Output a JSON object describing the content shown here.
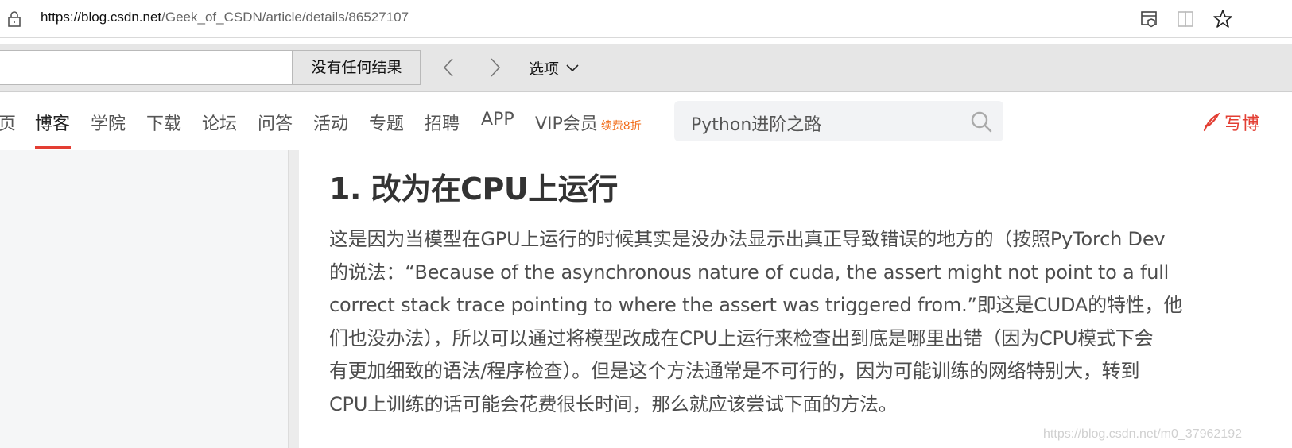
{
  "browser": {
    "url_host": "https://blog.csdn.net",
    "url_path": "/Geek_of_CSDN/article/details/86527107",
    "icons": [
      "lock-icon",
      "collections-icon",
      "reading-view-icon",
      "favorite-star-icon"
    ]
  },
  "find_bar": {
    "input_value": "",
    "result_label": "没有任何结果",
    "options_label": "选项"
  },
  "nav": {
    "items": [
      "页",
      "博客",
      "学院",
      "下载",
      "论坛",
      "问答",
      "活动",
      "专题",
      "招聘",
      "APP",
      "VIP会员"
    ],
    "active": "博客",
    "vip_badge": "续费8折",
    "search_text": "Python进阶之路",
    "write_label": "写博",
    "accent_color": "#e33e33"
  },
  "article": {
    "heading": "1. 改为在CPU上运行",
    "lines": [
      "这是因为当模型在GPU上运行的时候其实是没办法显示出真正导致错误的地方的（按照PyTorch Dev",
      "的说法：“Because of the asynchronous nature of cuda, the assert might not point to a full",
      "correct stack trace pointing to where the assert was triggered from.”即这是CUDA的特性，他",
      "们也没办法），所以可以通过将模型改成在CPU上运行来检查出到底是哪里出错（因为CPU模式下会",
      "有更加细致的语法/程序检查）。但是这个方法通常是不可行的，因为可能训练的网络特别大，转到",
      "CPU上训练的话可能会花费很长时间，那么就应该尝试下面的方法。"
    ],
    "watermark": "https://blog.csdn.net/m0_37962192"
  }
}
